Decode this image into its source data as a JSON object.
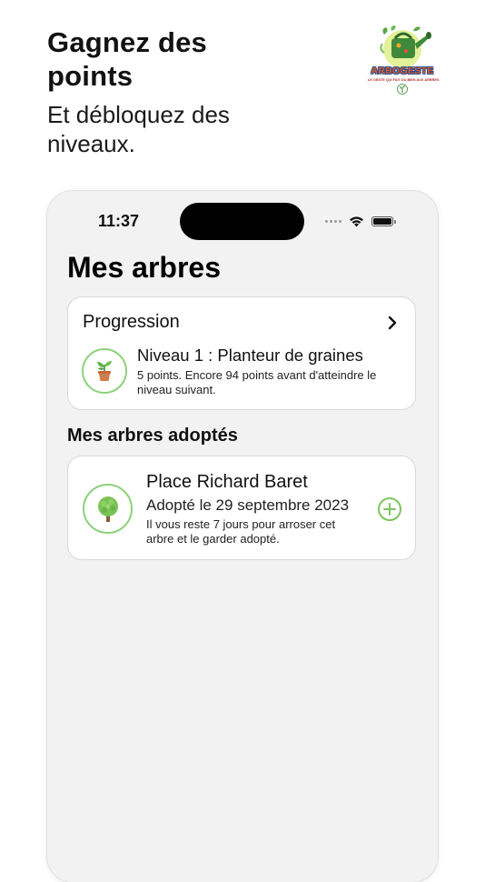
{
  "promo": {
    "title": "Gagnez des points",
    "subtitle": "Et débloquez des niveaux."
  },
  "logo": {
    "name": "ARBOGESTE",
    "tagline": "LE GESTE QUI FAIT DU BIEN AUX ARBRES",
    "icon": "watering-can-icon"
  },
  "status_bar": {
    "time": "11:37",
    "icons": [
      "signal-dots-icon",
      "wifi-icon",
      "battery-icon"
    ]
  },
  "screen": {
    "title": "Mes arbres"
  },
  "progression": {
    "heading": "Progression",
    "level_title": "Niveau 1 : Planteur de graines",
    "level_desc": "5 points. Encore 94 points avant d'atteindre le niveau suivant.",
    "level_icon": "potted-plant-icon",
    "chevron_icon": "chevron-right-icon"
  },
  "adopted": {
    "heading": "Mes arbres adoptés",
    "trees": [
      {
        "name": "Place Richard Baret",
        "date": "Adopté le 29 septembre 2023",
        "note": "Il vous reste 7 jours pour arroser cet arbre et le garder adopté.",
        "icon": "tree-icon",
        "action_icon": "plus-circle-icon"
      }
    ]
  },
  "colors": {
    "accent_green": "#8cd17a",
    "card_bg": "#ffffff",
    "screen_bg": "#f2f2f2"
  }
}
